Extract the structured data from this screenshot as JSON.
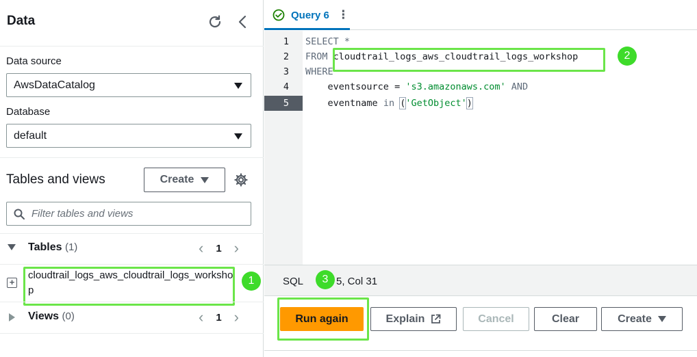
{
  "data_panel": {
    "title": "Data",
    "data_source_label": "Data source",
    "data_source_value": "AwsDataCatalog",
    "database_label": "Database",
    "database_value": "default",
    "tables_and_views_title": "Tables and views",
    "create_button_label": "Create",
    "filter_placeholder": "Filter tables and views",
    "tables_group": {
      "label": "Tables",
      "count": "(1)",
      "page": "1"
    },
    "table_items": [
      "cloudtrail_logs_aws_cloudtrail_logs_workshop"
    ],
    "views_group": {
      "label": "Views",
      "count": "(0)",
      "page": "1"
    }
  },
  "query_tab": {
    "label": "Query 6",
    "status": "completed"
  },
  "editor": {
    "line_numbers": [
      "1",
      "2",
      "3",
      "4",
      "5"
    ],
    "active_line": "5",
    "lines": {
      "l1": "SELECT *",
      "l2_kw": "FROM",
      "l2_table": "cloudtrail_logs_aws_cloudtrail_logs_workshop",
      "l3": "WHERE",
      "l4_field": "eventsource",
      "l4_eq": "=",
      "l4_value": "'s3.amazonaws.com'",
      "l4_and": "AND",
      "l5_field": "eventname",
      "l5_in": "in",
      "l5_open": "(",
      "l5_value": "'GetObject'",
      "l5_close": ")"
    }
  },
  "status_bar": {
    "language": "SQL",
    "position": "5, Col 31"
  },
  "footer": {
    "run_again": "Run again",
    "explain": "Explain",
    "cancel": "Cancel",
    "clear": "Clear",
    "create": "Create"
  },
  "annotations": {
    "m1": "1",
    "m2": "2",
    "m3": "3"
  },
  "colors": {
    "highlight": "#6be549",
    "marker": "#3edb2a",
    "primary": "#ff9900",
    "link": "#0073bb"
  }
}
